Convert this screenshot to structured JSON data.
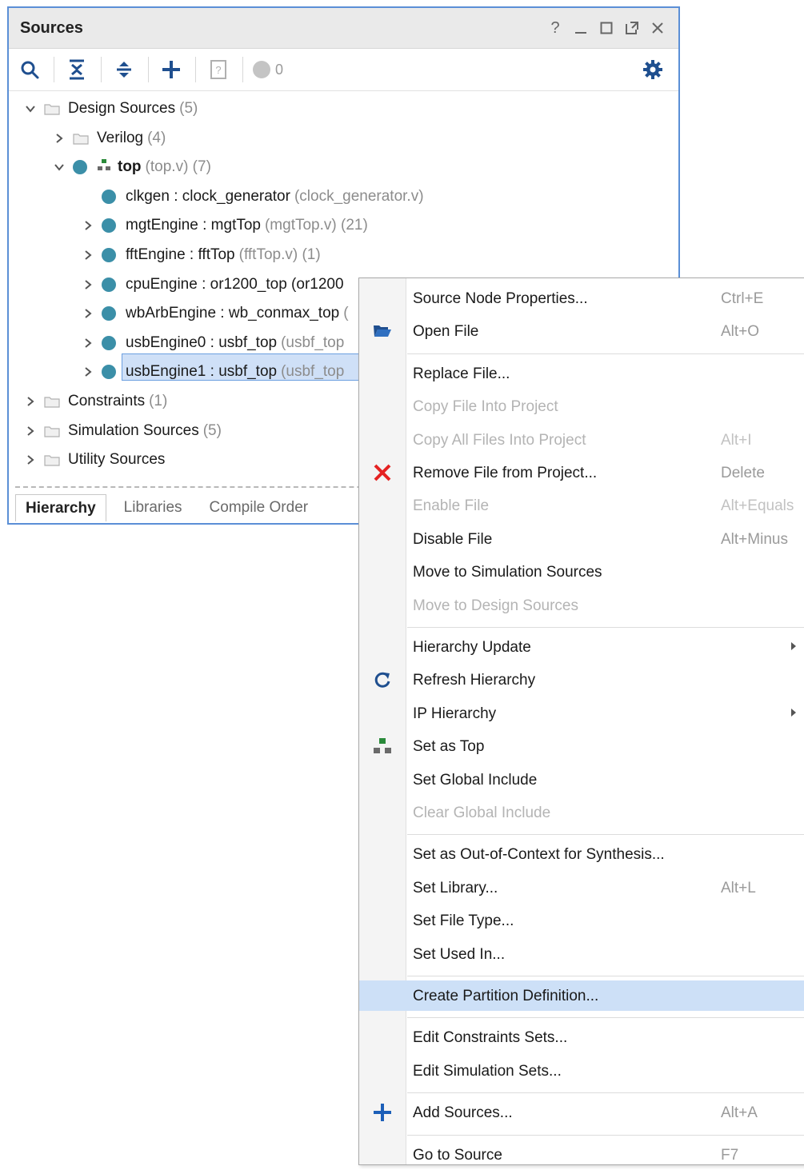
{
  "panel": {
    "title": "Sources",
    "window_controls": [
      "?",
      "minimize",
      "maximize",
      "float",
      "close"
    ],
    "toolbar": {
      "items": [
        "search-icon",
        "collapse-all-icon",
        "expand-all-icon",
        "add-icon",
        "help-doc-icon",
        "status-dot-icon",
        "gear-icon"
      ],
      "status_count": "0"
    },
    "tree": [
      {
        "name": "Design Sources",
        "suffix": "(5)",
        "indent": 0,
        "chevron": "down",
        "kind": "folder"
      },
      {
        "name": "Verilog",
        "suffix": "(4)",
        "indent": 1,
        "chevron": "right",
        "kind": "folder"
      },
      {
        "name": "top",
        "suffix": "(top.v) (7)",
        "indent": 1,
        "chevron": "down",
        "kind": "top"
      },
      {
        "name": "clkgen : clock_generator",
        "suffix": "(clock_generator.v)",
        "indent": 2,
        "chevron": "none",
        "kind": "module"
      },
      {
        "name": "mgtEngine : mgtTop",
        "suffix": "(mgtTop.v) (21)",
        "indent": 2,
        "chevron": "right",
        "kind": "module"
      },
      {
        "name": "fftEngine : fftTop",
        "suffix": "(fftTop.v) (1)",
        "indent": 2,
        "chevron": "right",
        "kind": "module"
      },
      {
        "name": "cpuEngine : or1200_top (or1200",
        "suffix": "",
        "indent": 2,
        "chevron": "right",
        "kind": "module",
        "selected": true
      },
      {
        "name": "wbArbEngine : wb_conmax_top",
        "suffix": "(",
        "indent": 2,
        "chevron": "right",
        "kind": "module"
      },
      {
        "name": "usbEngine0 : usbf_top",
        "suffix": "(usbf_top",
        "indent": 2,
        "chevron": "right",
        "kind": "module"
      },
      {
        "name": "usbEngine1 : usbf_top",
        "suffix": "(usbf_top",
        "indent": 2,
        "chevron": "right",
        "kind": "module"
      },
      {
        "name": "Constraints",
        "suffix": "(1)",
        "indent": 0,
        "chevron": "right",
        "kind": "folder"
      },
      {
        "name": "Simulation Sources",
        "suffix": "(5)",
        "indent": 0,
        "chevron": "right",
        "kind": "folder"
      },
      {
        "name": "Utility Sources",
        "suffix": "",
        "indent": 0,
        "chevron": "right",
        "kind": "folder"
      }
    ],
    "tabs": [
      {
        "label": "Hierarchy",
        "active": true
      },
      {
        "label": "Libraries",
        "active": false
      },
      {
        "label": "Compile Order",
        "active": false
      }
    ]
  },
  "menu": {
    "items": [
      {
        "label": "Source Node Properties...",
        "shortcut": "Ctrl+E",
        "icon": "",
        "disabled": false
      },
      {
        "label": "Open File",
        "shortcut": "Alt+O",
        "icon": "folder-open-icon",
        "disabled": false
      },
      {
        "sep": true
      },
      {
        "label": "Replace File...",
        "shortcut": "",
        "icon": "",
        "disabled": false
      },
      {
        "label": "Copy File Into Project",
        "shortcut": "",
        "icon": "",
        "disabled": true
      },
      {
        "label": "Copy All Files Into Project",
        "shortcut": "Alt+I",
        "icon": "",
        "disabled": true
      },
      {
        "label": "Remove File from Project...",
        "shortcut": "Delete",
        "icon": "remove-x-icon",
        "disabled": false
      },
      {
        "label": "Enable File",
        "shortcut": "Alt+Equals",
        "icon": "",
        "disabled": true
      },
      {
        "label": "Disable File",
        "shortcut": "Alt+Minus",
        "icon": "",
        "disabled": false
      },
      {
        "label": "Move to Simulation Sources",
        "shortcut": "",
        "icon": "",
        "disabled": false
      },
      {
        "label": "Move to Design Sources",
        "shortcut": "",
        "icon": "",
        "disabled": true
      },
      {
        "sep": true
      },
      {
        "label": "Hierarchy Update",
        "shortcut": "",
        "icon": "",
        "disabled": false,
        "submenu": true
      },
      {
        "label": "Refresh Hierarchy",
        "shortcut": "",
        "icon": "refresh-icon",
        "disabled": false
      },
      {
        "label": "IP Hierarchy",
        "shortcut": "",
        "icon": "",
        "disabled": false,
        "submenu": true
      },
      {
        "label": "Set as Top",
        "shortcut": "",
        "icon": "hierarchy-top-icon",
        "disabled": false
      },
      {
        "label": "Set Global Include",
        "shortcut": "",
        "icon": "",
        "disabled": false
      },
      {
        "label": "Clear Global Include",
        "shortcut": "",
        "icon": "",
        "disabled": true
      },
      {
        "sep": true
      },
      {
        "label": "Set as Out-of-Context for Synthesis...",
        "shortcut": "",
        "icon": "",
        "disabled": false
      },
      {
        "label": "Set Library...",
        "shortcut": "Alt+L",
        "icon": "",
        "disabled": false
      },
      {
        "label": "Set File Type...",
        "shortcut": "",
        "icon": "",
        "disabled": false
      },
      {
        "label": "Set Used In...",
        "shortcut": "",
        "icon": "",
        "disabled": false
      },
      {
        "sep": true
      },
      {
        "label": "Create Partition Definition...",
        "shortcut": "",
        "icon": "",
        "disabled": false,
        "highlighted": true
      },
      {
        "sep": true
      },
      {
        "label": "Edit Constraints Sets...",
        "shortcut": "",
        "icon": "",
        "disabled": false
      },
      {
        "label": "Edit Simulation Sets...",
        "shortcut": "",
        "icon": "",
        "disabled": false
      },
      {
        "sep": true
      },
      {
        "label": "Add Sources...",
        "shortcut": "Alt+A",
        "icon": "add-plus-icon",
        "disabled": false
      },
      {
        "sep": true
      },
      {
        "label": "Go to Source",
        "shortcut": "F7",
        "icon": "",
        "disabled": false
      }
    ]
  },
  "colors": {
    "panel_border": "#5b8fd6",
    "selection_bg": "#cfe0f7",
    "menu_highlight": "#cde0f7",
    "module_dot": "#3b8fa8",
    "remove_red": "#e52222",
    "add_blue": "#1c5fb8"
  }
}
